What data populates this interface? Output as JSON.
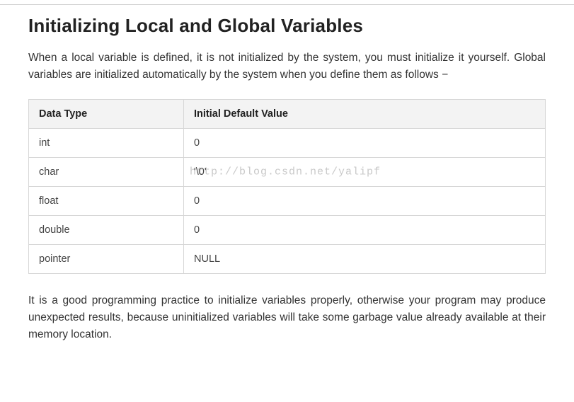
{
  "heading": "Initializing Local and Global Variables",
  "intro": "When a local variable is defined, it is not initialized by the system, you must initialize it yourself. Global variables are initialized automatically by the system when you define them as follows −",
  "table": {
    "col1": "Data Type",
    "col2": "Initial Default Value",
    "rows": [
      {
        "type": "int",
        "value": "0"
      },
      {
        "type": "char",
        "value": "'\\0'"
      },
      {
        "type": "float",
        "value": "0"
      },
      {
        "type": "double",
        "value": "0"
      },
      {
        "type": "pointer",
        "value": "NULL"
      }
    ]
  },
  "watermark": "http://blog.csdn.net/yalipf",
  "outro": "It is a good programming practice to initialize variables properly, otherwise your program may produce unexpected results, because uninitialized variables will take some garbage value already available at their memory location."
}
